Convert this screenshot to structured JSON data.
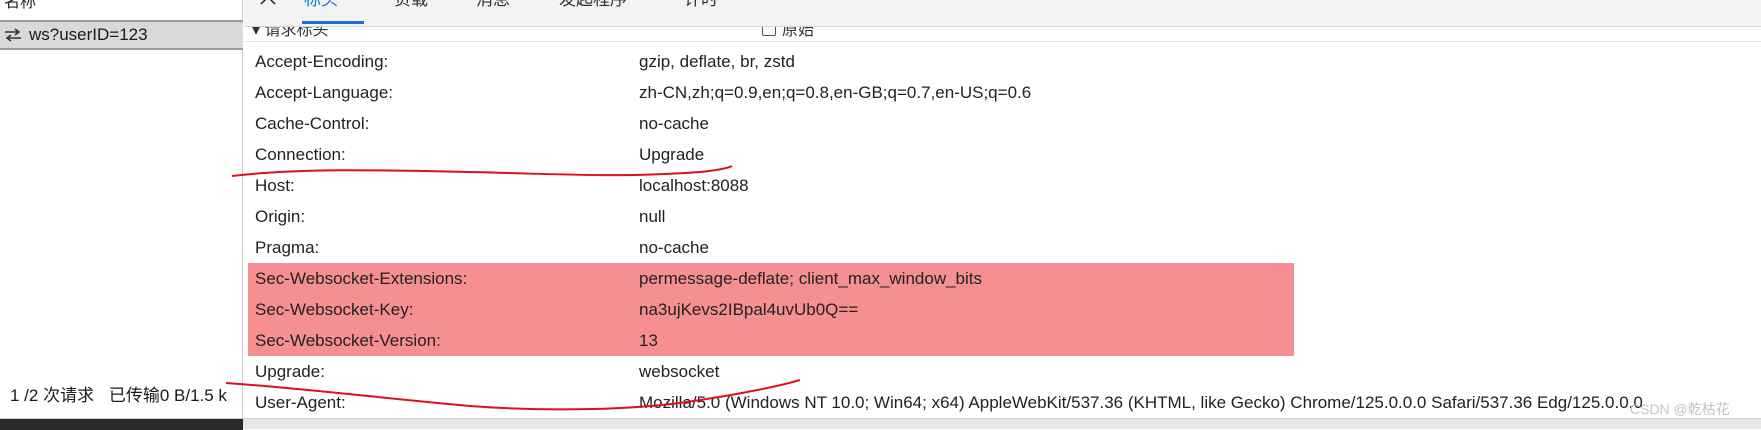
{
  "left_panel": {
    "header_label": "名称",
    "request": {
      "icon": "websocket-arrows-icon",
      "name": "ws?userID=123"
    },
    "status": {
      "requests": "1 /2 次请求",
      "transferred": "已传输0 B/1.5 k"
    }
  },
  "tabs": {
    "close_icon": "close-icon",
    "items": [
      {
        "label": "标头",
        "active": true
      },
      {
        "label": "负载",
        "active": false
      },
      {
        "label": "消息",
        "active": false
      },
      {
        "label": "发起程序",
        "active": false
      },
      {
        "label": "计时",
        "active": false
      }
    ]
  },
  "section": {
    "title": "▾ 请求标头",
    "raw_checkbox_label": "原始"
  },
  "request_headers": [
    {
      "name": "Accept-Encoding:",
      "value": "gzip, deflate, br, zstd",
      "highlighted": false
    },
    {
      "name": "Accept-Language:",
      "value": "zh-CN,zh;q=0.9,en;q=0.8,en-GB;q=0.7,en-US;q=0.6",
      "highlighted": false
    },
    {
      "name": "Cache-Control:",
      "value": "no-cache",
      "highlighted": false
    },
    {
      "name": "Connection:",
      "value": "Upgrade",
      "highlighted": false
    },
    {
      "name": "Host:",
      "value": "localhost:8088",
      "highlighted": false
    },
    {
      "name": "Origin:",
      "value": "null",
      "highlighted": false
    },
    {
      "name": "Pragma:",
      "value": "no-cache",
      "highlighted": false
    },
    {
      "name": "Sec-Websocket-Extensions:",
      "value": "permessage-deflate; client_max_window_bits",
      "highlighted": true
    },
    {
      "name": "Sec-Websocket-Key:",
      "value": "na3ujKevs2IBpal4uvUb0Q==",
      "highlighted": true
    },
    {
      "name": "Sec-Websocket-Version:",
      "value": "13",
      "highlighted": true
    },
    {
      "name": "Upgrade:",
      "value": "websocket",
      "highlighted": false
    },
    {
      "name": "User-Agent:",
      "value": "Mozilla/5.0 (Windows NT 10.0; Win64; x64) AppleWebKit/537.36 (KHTML, like Gecko) Chrome/125.0.0.0 Safari/537.36 Edg/125.0.0.0",
      "highlighted": false
    }
  ],
  "colors": {
    "highlight": "#f58f91",
    "annotation_red": "#e0101a",
    "active_tab": "#1a6fd8"
  },
  "watermark": "CSDN @乾枯花"
}
